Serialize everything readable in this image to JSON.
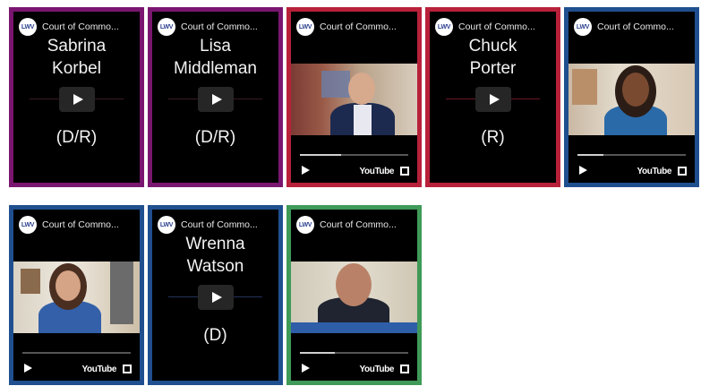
{
  "channel": "Court of Commo...",
  "logo_text": "LWV",
  "cards": [
    {
      "type": "text",
      "name": "Sabrina Korbel",
      "name_l1": "Sabrina",
      "name_l2": "Korbel",
      "party": "(D/R)",
      "color": "#7a1670"
    },
    {
      "type": "text",
      "name": "Lisa Middleman",
      "name_l1": "Lisa",
      "name_l2": "Middleman",
      "party": "(D/R)",
      "color": "#7a1670"
    },
    {
      "type": "video",
      "color": "#b8213a"
    },
    {
      "type": "text",
      "name": "Chuck Porter",
      "name_l1": "Chuck",
      "name_l2": "Porter",
      "party": "(R)",
      "color": "#b8213a"
    },
    {
      "type": "video",
      "color": "#1f4f8f"
    },
    {
      "type": "video",
      "color": "#1f4f8f"
    },
    {
      "type": "text",
      "name": "Wrenna Watson",
      "name_l1": "Wrenna",
      "name_l2": "Watson",
      "party": "(D)",
      "color": "#1f4f8f"
    },
    {
      "type": "video",
      "color": "#3f9a58"
    }
  ],
  "youtube_label": "YouTube"
}
